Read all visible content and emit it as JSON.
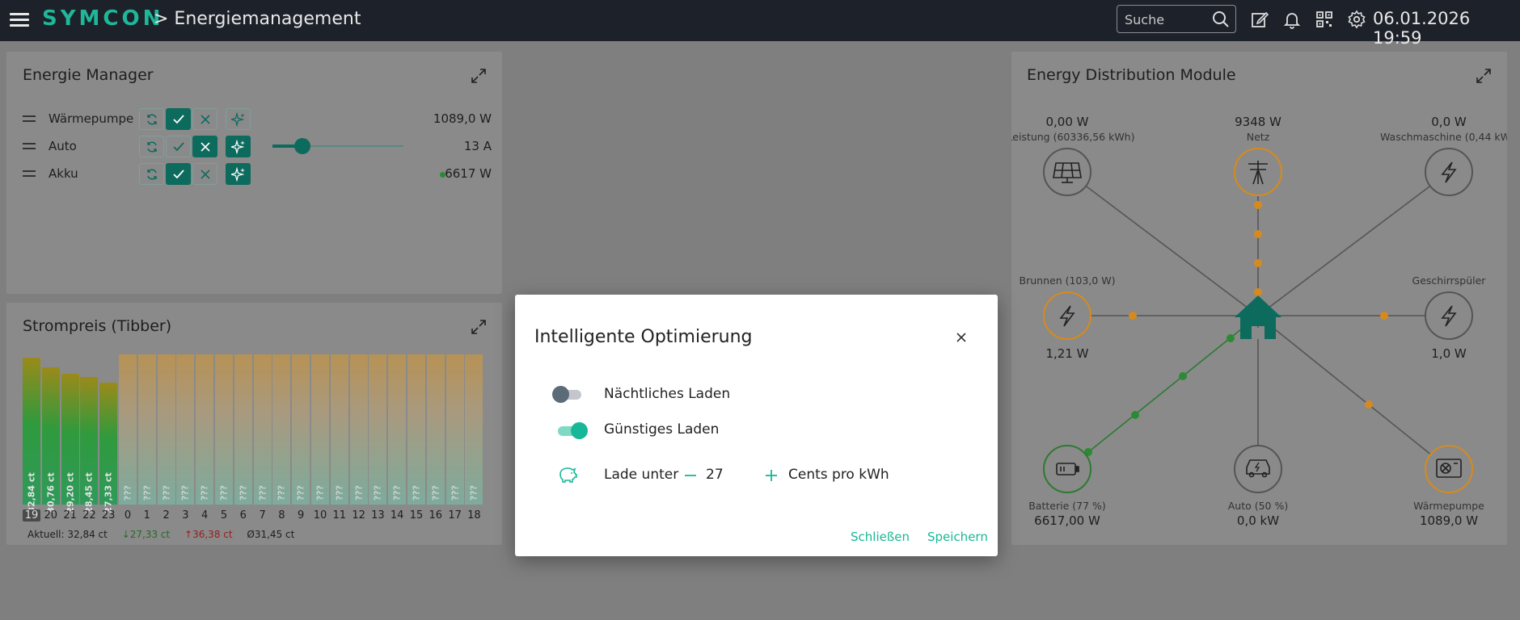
{
  "header": {
    "logo": "SYMCON",
    "title": "> Energiemanagement",
    "search_placeholder": "Suche",
    "datetime": "06.01.2026 19:59"
  },
  "energy_manager": {
    "title": "Energie Manager",
    "rows": [
      {
        "label": "Wärmepumpe",
        "value": "1089,0 W"
      },
      {
        "label": "Auto",
        "value": "13 A",
        "slider_level": 0.23
      },
      {
        "label": "Akku",
        "value": "6617 W"
      }
    ]
  },
  "strompreis": {
    "title": "Strompreis (Tibber)",
    "bar_labels": [
      "32,84 ct",
      "30,76 ct",
      "29,20 ct",
      "28,45 ct",
      "27,33 ct"
    ],
    "hours": [
      "19",
      "20",
      "21",
      "22",
      "23",
      "0",
      "1",
      "2",
      "3",
      "4",
      "5",
      "6",
      "7",
      "8",
      "9",
      "10",
      "11",
      "12",
      "13",
      "14",
      "15",
      "16",
      "17",
      "18"
    ],
    "unknown_label": "???",
    "stats": {
      "current": "Aktuell: 32,84 ct",
      "min": "↓27,33 ct",
      "max": "↑36,38 ct",
      "avg": "Ø31,45 ct"
    }
  },
  "chart_data": {
    "type": "bar",
    "categories": [
      "19",
      "20",
      "21",
      "22",
      "23",
      "0",
      "1",
      "2",
      "3",
      "4",
      "5",
      "6",
      "7",
      "8",
      "9",
      "10",
      "11",
      "12",
      "13",
      "14",
      "15",
      "16",
      "17",
      "18"
    ],
    "values": [
      32.84,
      30.76,
      29.2,
      28.45,
      27.33,
      null,
      null,
      null,
      null,
      null,
      null,
      null,
      null,
      null,
      null,
      null,
      null,
      null,
      null,
      null,
      null,
      null,
      null,
      null
    ],
    "title": "Strompreis (Tibber)",
    "xlabel": "",
    "ylabel": "",
    "ylim": [
      0,
      37
    ],
    "grid": false
  },
  "modal": {
    "title": "Intelligente Optimierung",
    "nightly_label": "Nächtliches Laden",
    "nightly_on": false,
    "cheap_label": "Günstiges Laden",
    "cheap_on": true,
    "charge_below_label": "Lade unter",
    "charge_below_value": "27",
    "unit_label": "Cents pro kWh",
    "close_label": "Schließen",
    "save_label": "Speichern"
  },
  "edm": {
    "title": "Energy Distribution Module",
    "nodes": {
      "pv": {
        "value": "0,00 W",
        "label": "-Leistung (60336,56 kWh)"
      },
      "netz": {
        "value": "9348 W",
        "label": "Netz"
      },
      "waschmaschine": {
        "value": "0,0 W",
        "label": "Waschmaschine (0,44 kW"
      },
      "brunnen": {
        "label": "Brunnen (103,0 W)",
        "value": "1,21 W"
      },
      "geschirrspueler": {
        "label": "Geschirrspüler",
        "value": "1,0 W"
      },
      "batterie": {
        "label": "Batterie (77 %)",
        "value": "6617,00 W"
      },
      "auto": {
        "label": "Auto (50 %)",
        "value": "0,0 kW"
      },
      "waermepumpe": {
        "label": "Wärmepumpe",
        "value": "1089,0 W"
      }
    }
  },
  "colors": {
    "accent": "#17b897",
    "active_button": "#0d6b5e",
    "orange": "#e0901f",
    "green": "#3a9b3e",
    "header_bg": "#1d2129"
  }
}
